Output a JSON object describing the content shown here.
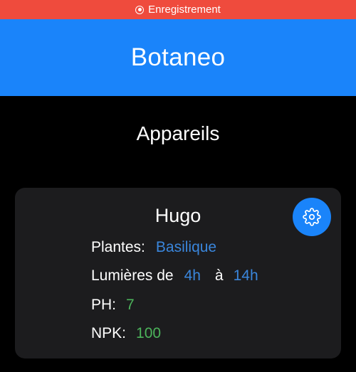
{
  "status_bar": {
    "recording_label": "Enregistrement",
    "icon": "record-icon",
    "color": "#ef4b3d"
  },
  "header": {
    "title": "Botaneo",
    "color": "#1a84fa"
  },
  "section": {
    "title": "Appareils"
  },
  "device": {
    "name": "Hugo",
    "settings_icon": "gear-icon",
    "plants": {
      "label": "Plantes:",
      "value": "Basilique"
    },
    "light": {
      "label": "Lumières de",
      "start": "4h",
      "separator": "à",
      "end": "14h"
    },
    "ph": {
      "label": "PH:",
      "value": "7"
    },
    "npk": {
      "label": "NPK:",
      "value": "100"
    }
  },
  "colors": {
    "accent_blue": "#3a86dc",
    "value_green": "#4cb35b",
    "card_background": "#1c1c1e"
  }
}
